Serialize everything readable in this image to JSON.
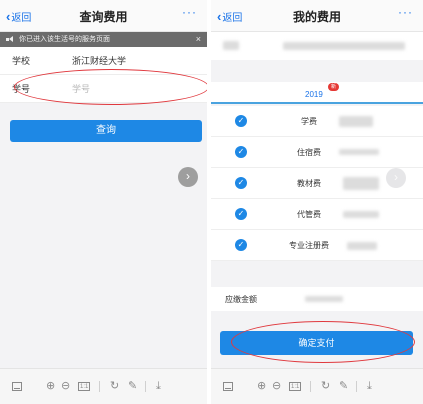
{
  "left": {
    "nav": {
      "back_label": "返回",
      "title": "查询费用",
      "more": "···"
    },
    "notice": {
      "text": "你已进入该生活号的服务页面",
      "close": "×"
    },
    "form": {
      "school_label": "学校",
      "school_value": "浙江财经大学",
      "student_id_label": "学号",
      "student_id_placeholder": "学号"
    },
    "query_button": "查询",
    "fab": "›"
  },
  "right": {
    "nav": {
      "back_label": "返回",
      "title": "我的费用",
      "more": "···"
    },
    "year": "2019",
    "year_badge": "新",
    "items": [
      {
        "name": "学费"
      },
      {
        "name": "住宿费"
      },
      {
        "name": "教材费"
      },
      {
        "name": "代管费"
      },
      {
        "name": "专业注册费"
      }
    ],
    "check_glyph": "✓",
    "amount_label": "应缴金额",
    "pay_button": "确定支付",
    "fab": "›"
  },
  "toolbar": {
    "zoom_in": "⊕",
    "zoom_out": "⊖",
    "fit": "1:1",
    "rotate": "↻",
    "annotate": "✎",
    "download": "⤓"
  },
  "colors": {
    "accent": "#1e88e5",
    "annotation": "#e0393e"
  }
}
